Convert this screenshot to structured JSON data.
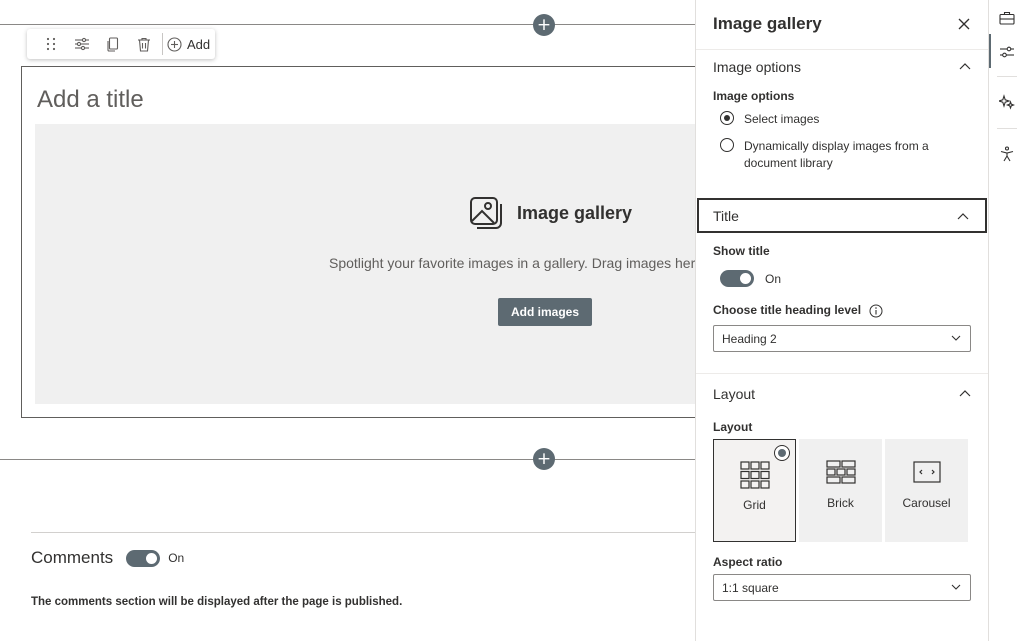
{
  "toolbar": {
    "add_label": "Add"
  },
  "webpart": {
    "title_placeholder": "Add a title",
    "gallery_title": "Image gallery",
    "description": "Spotlight your favorite images in a gallery. Drag images here",
    "add_images_label": "Add images"
  },
  "comments": {
    "title": "Comments",
    "toggle_text": "On",
    "note": "The comments section will be displayed after the page is published."
  },
  "panel": {
    "header": "Image gallery",
    "image_options": {
      "section_label": "Image options",
      "group_label": "Image options",
      "options": [
        {
          "label": "Select images",
          "selected": true
        },
        {
          "label": "Dynamically display images from a document library",
          "selected": false
        }
      ]
    },
    "title_section": {
      "section_label": "Title",
      "show_title_label": "Show title",
      "show_title_state": "On",
      "heading_level_label": "Choose title heading level",
      "heading_level_value": "Heading 2"
    },
    "layout_section": {
      "section_label": "Layout",
      "layout_label": "Layout",
      "tiles": [
        {
          "label": "Grid",
          "selected": true
        },
        {
          "label": "Brick",
          "selected": false
        },
        {
          "label": "Carousel",
          "selected": false
        }
      ],
      "aspect_ratio_label": "Aspect ratio",
      "aspect_ratio_value": "1:1 square"
    }
  },
  "icons": {
    "rail": [
      "briefcase-icon",
      "sliders-icon",
      "sparkle-icon",
      "accessibility-icon"
    ]
  },
  "colors": {
    "accent": "#5d6a72",
    "placeholder_bg": "#f0f0f0"
  }
}
